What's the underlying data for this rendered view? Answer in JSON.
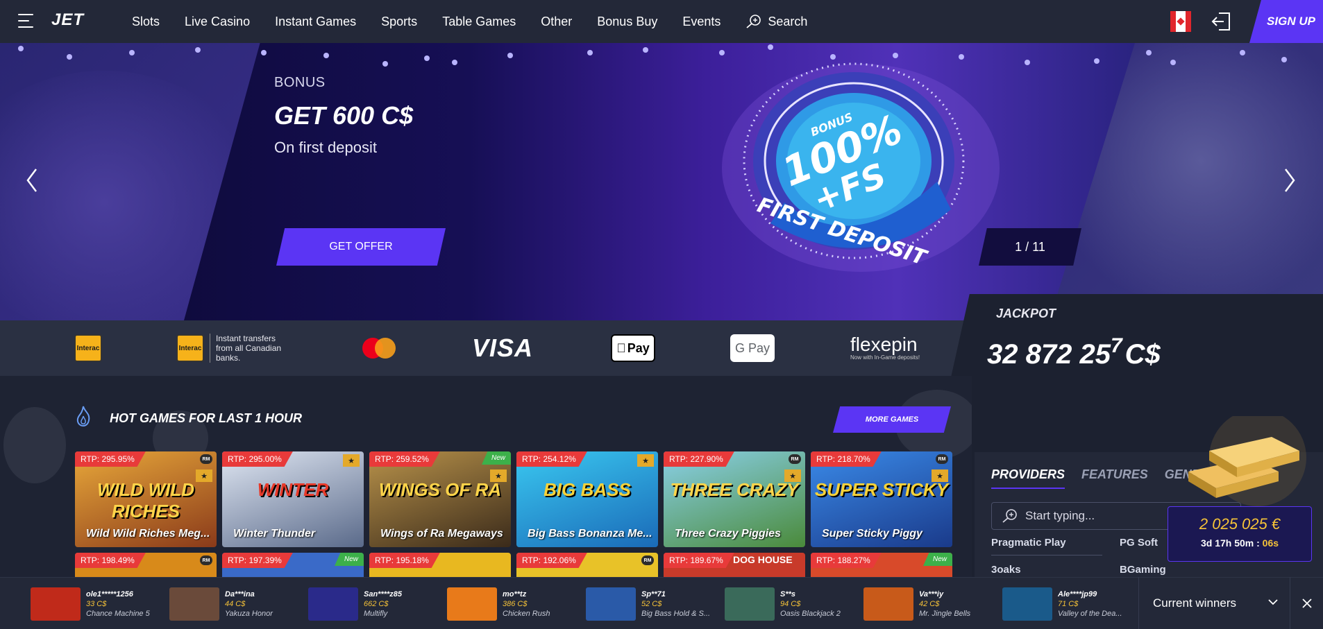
{
  "header": {
    "logo": "JET",
    "nav": [
      "Slots",
      "Live Casino",
      "Instant Games",
      "Sports",
      "Table Games",
      "Other",
      "Bonus Buy",
      "Events"
    ],
    "search_label": "Search",
    "signup_label": "SIGN UP",
    "flag": "canada-flag-icon"
  },
  "hero": {
    "kicker": "BONUS",
    "title": "GET 600 C$",
    "subtitle": "On first deposit",
    "cta": "GET OFFER",
    "slide_counter": "1 / 11",
    "badge_top": "BONUS",
    "badge_main_1": "100%",
    "badge_main_2": "+FS",
    "badge_ring": "FIRST DEPOSIT"
  },
  "payments": {
    "interac_logo": "Interac",
    "interac_note": "Instant transfers from all Canadian banks.",
    "visa": "VISA",
    "apple_pay": "Pay",
    "google_pay": "G Pay",
    "flexepin": "flexepin",
    "flexepin_note": "Now with In-Game deposits!"
  },
  "jackpot": {
    "label": "JACKPOT",
    "value_main": "32 872 25",
    "value_digit": "7",
    "currency": "C$"
  },
  "hot_games": {
    "title": "HOT GAMES FOR LAST 1 HOUR",
    "more_label": "MORE GAMES",
    "row1": [
      {
        "rtp": "RTP: 295.95%",
        "name": "Wild Wild Riches Meg...",
        "art": "WILD WILD RICHES",
        "rm": "RM",
        "trophy": true,
        "new": false,
        "bg": "#c0742a"
      },
      {
        "rtp": "RTP: 295.00%",
        "name": "Winter Thunder",
        "art": "WINTER",
        "rm": "",
        "trophy": true,
        "new": false,
        "bg": "#8a98b8"
      },
      {
        "rtp": "RTP: 259.52%",
        "name": "Wings of Ra Megaways",
        "art": "WINGS OF RA",
        "rm": "",
        "trophy": true,
        "new": true,
        "bg": "#7a5a32"
      },
      {
        "rtp": "RTP: 254.12%",
        "name": "Big Bass Bonanza Me...",
        "art": "BIG BASS",
        "rm": "",
        "trophy": true,
        "new": false,
        "bg": "#2aa0d8"
      },
      {
        "rtp": "RTP: 227.90%",
        "name": "Three Crazy Piggies",
        "art": "THREE CRAZY",
        "rm": "RM",
        "trophy": true,
        "new": false,
        "bg": "#6aa84a"
      },
      {
        "rtp": "RTP: 218.70%",
        "name": "Super Sticky Piggy",
        "art": "SUPER STICKY",
        "rm": "RM",
        "trophy": true,
        "new": false,
        "bg": "#2a68c8"
      }
    ],
    "row2": [
      {
        "rtp": "RTP: 198.49%",
        "rm": "RM",
        "new": false,
        "bg": "#d88a1a"
      },
      {
        "rtp": "RTP: 197.39%",
        "rm": "",
        "new": true,
        "bg": "#3a6ac8"
      },
      {
        "rtp": "RTP: 195.18%",
        "rm": "",
        "new": false,
        "bg": "#e8b820"
      },
      {
        "rtp": "RTP: 192.06%",
        "rm": "RM",
        "new": false,
        "bg": "#e8c228"
      },
      {
        "rtp": "RTP: 189.67%",
        "rm": "",
        "new": false,
        "bg": "#c83a2a",
        "art": "DOG HOUSE"
      },
      {
        "rtp": "RTP: 188.27%",
        "rm": "",
        "new": true,
        "bg": "#d84a2a"
      }
    ]
  },
  "side": {
    "tabs": [
      "PROVIDERS",
      "FEATURES",
      "GENRES"
    ],
    "search_placeholder": "Start typing...",
    "providers_left": [
      "Pragmatic Play",
      "3oaks"
    ],
    "providers_right": [
      "PG Soft",
      "BGaming"
    ],
    "promo_amount": "2 025 025 €",
    "promo_timer_main": "3d 17h 50m : ",
    "promo_timer_sec": "06s"
  },
  "winners": {
    "items": [
      {
        "user": "ole1*****1256",
        "amount": "33 C$",
        "game": "Chance Machine 5",
        "bg": "#c02a1a"
      },
      {
        "user": "Da***ina",
        "amount": "44 C$",
        "game": "Yakuza Honor",
        "bg": "#6a4a3a"
      },
      {
        "user": "San****z85",
        "amount": "662 C$",
        "game": "Multifly",
        "bg": "#2a2a8a"
      },
      {
        "user": "mo**tz",
        "amount": "386 C$",
        "game": "Chicken Rush",
        "bg": "#e87a1a"
      },
      {
        "user": "Sp**71",
        "amount": "52 C$",
        "game": "Big Bass Hold & S...",
        "bg": "#2a5aa8"
      },
      {
        "user": "S**s",
        "amount": "94 C$",
        "game": "Oasis Blackjack 2",
        "bg": "#3a6a5a"
      },
      {
        "user": "Va***iy",
        "amount": "42 C$",
        "game": "Mr. Jingle Bells",
        "bg": "#c85a1a"
      },
      {
        "user": "Ale****jp99",
        "amount": "71 C$",
        "game": "Valley of the Dea...",
        "bg": "#1a5a8a"
      }
    ],
    "current_label": "Current winners"
  }
}
